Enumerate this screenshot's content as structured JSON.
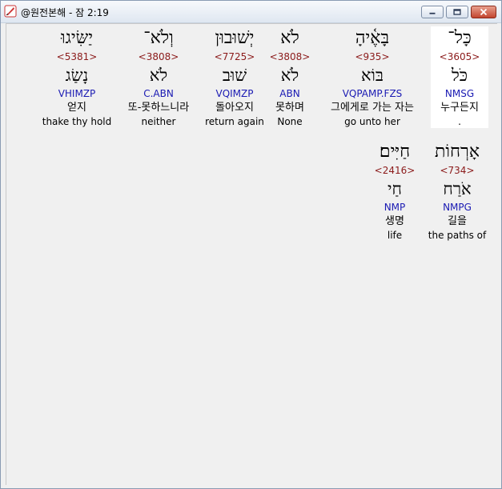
{
  "window": {
    "title": "@원전본해 - 잠 2:19",
    "icon": "quill-icon"
  },
  "rows": [
    {
      "words": [
        {
          "hebrew": "כָּל־",
          "strong": "<3605>",
          "lemma": "כֹּל",
          "morph": "NMSG",
          "korean": "누구든지",
          "english": ".",
          "highlight": true
        },
        {
          "hebrew": "בָּאֶ֫יהָ",
          "strong": "<935>",
          "lemma": "בּוֹא",
          "morph": "VQPAMP.FZS",
          "korean": "그에게로 가는 자는",
          "english": "go unto her",
          "highlight": false
        },
        {
          "hebrew": "לֹא",
          "strong": "<3808>",
          "lemma": "לֹא",
          "morph": "ABN",
          "korean": "못하며",
          "english": "None",
          "highlight": false
        },
        {
          "hebrew": "יְשׁוּבוּן",
          "strong": "<7725>",
          "lemma": "שׁוּב",
          "morph": "VQIMZP",
          "korean": "돌아오지",
          "english": "return again",
          "highlight": false
        },
        {
          "hebrew": "וְלֹא־",
          "strong": "<3808>",
          "lemma": "לֹא",
          "morph": "C.ABN",
          "korean": "또-못하느니라",
          "english": "neither",
          "highlight": false
        },
        {
          "hebrew": "יַשִּׂיגוּ",
          "strong": "<5381>",
          "lemma": "נָשַׂג",
          "morph": "VHIMZP",
          "korean": "얻지",
          "english": "thake thy hold",
          "highlight": false
        }
      ]
    },
    {
      "words": [
        {
          "hebrew": "אָרְחוֹת",
          "strong": "<734>",
          "lemma": "אֹרַח",
          "morph": "NMPG",
          "korean": "길을",
          "english": "the paths of",
          "highlight": false
        },
        {
          "hebrew": "חַיִּים׃",
          "strong": "<2416>",
          "lemma": "חַי",
          "morph": "NMP",
          "korean": "생명",
          "english": "life",
          "highlight": false
        }
      ]
    }
  ]
}
